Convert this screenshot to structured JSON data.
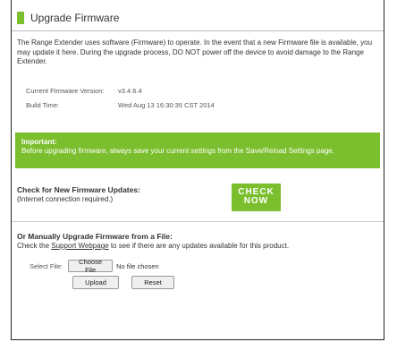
{
  "header": {
    "title": "Upgrade Firmware"
  },
  "intro": {
    "text": "The Range Extender uses software (Firmware) to operate. In the event that a new Firmware file is available, you may update it here. During the upgrade process, DO NOT power off the device to avoid damage to the Range Extender."
  },
  "info": {
    "version_label": "Current Firmware Version:",
    "version_value": "v3.4.6.4",
    "build_label": "Build Time:",
    "build_value": "Wed Aug 13 16:30:35 CST 2014"
  },
  "important": {
    "heading": "Important:",
    "text": "Before upgrading firmware, always save your current settings from the Save/Reload Settings page."
  },
  "check_updates": {
    "title": "Check for New Firmware Updates:",
    "subtitle": "(Internet connection required.)",
    "button_line1": "CHECK",
    "button_line2": "NOW"
  },
  "manual": {
    "title": "Or Manually Upgrade Firmware from a File:",
    "desc_prefix": "Check the ",
    "link_text": "Support Webpage",
    "desc_suffix": " to see if there are any updates available for this product.",
    "file_label": "Select File:",
    "choose_button": "Choose File",
    "no_file_text": "No file chosen",
    "upload_button": "Upload",
    "reset_button": "Reset"
  },
  "colors": {
    "accent": "#7bbf2e",
    "text": "#333333"
  }
}
